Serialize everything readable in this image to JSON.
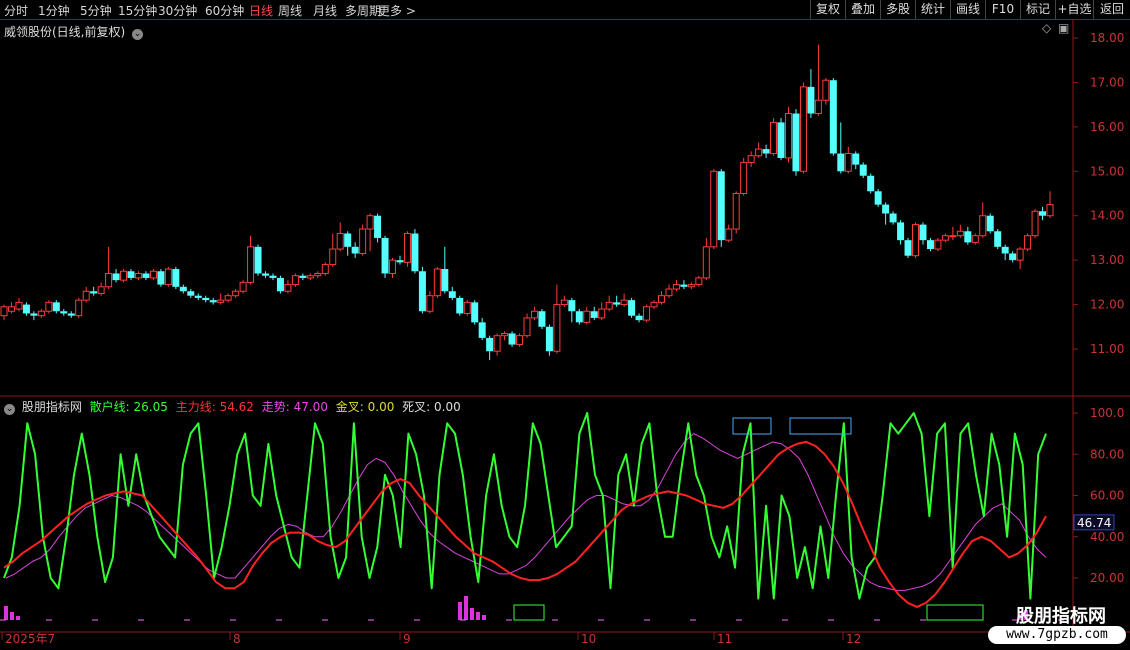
{
  "toolbar": {
    "timeframes": [
      "分时",
      "1分钟",
      "5分钟",
      "15分钟",
      "30分钟",
      "60分钟",
      "日线",
      "周线",
      "月线",
      "多周期",
      "更多 >"
    ],
    "active_timeframe": "日线",
    "right_buttons": [
      "复权",
      "叠加",
      "多股",
      "统计",
      "画线",
      "F10",
      "标记",
      "+自选",
      "返回"
    ]
  },
  "main_panel": {
    "title": "威领股份(日线,前复权)",
    "y_ticks": [
      "18.00",
      "17.00",
      "16.00",
      "15.00",
      "14.00",
      "13.00",
      "12.00",
      "11.00"
    ]
  },
  "indicator_panel": {
    "title": "股朋指标网",
    "legend": [
      {
        "label": "散户线: 26.05",
        "color": "#33ff33"
      },
      {
        "label": "主力线: 54.62",
        "color": "#ff3333"
      },
      {
        "label": "走势: 47.00",
        "color": "#ee44ee"
      },
      {
        "label": "金叉: 0.00",
        "color": "#dddd33"
      },
      {
        "label": "死叉: 0.00",
        "color": "#dddddd"
      }
    ],
    "y_ticks": [
      "100.0",
      "80.00",
      "60.00",
      "40.00",
      "20.00"
    ],
    "current_value": "46.74"
  },
  "x_axis": {
    "labels": [
      "2025年7",
      "8",
      "9",
      "10",
      "11",
      "12"
    ]
  },
  "watermark": {
    "name": "股朋指标网",
    "url": "www.7gpzb.com"
  },
  "chart_data": {
    "type": "candlestick",
    "candles": [
      [
        11.75,
        11.95,
        12.0,
        11.65
      ],
      [
        11.85,
        11.95,
        12.05,
        11.8
      ],
      [
        11.9,
        12.05,
        12.15,
        11.85
      ],
      [
        12.0,
        11.8,
        12.05,
        11.75
      ],
      [
        11.8,
        11.75,
        11.85,
        11.65
      ],
      [
        11.75,
        11.85,
        11.9,
        11.7
      ],
      [
        11.85,
        12.05,
        12.1,
        11.8
      ],
      [
        12.05,
        11.85,
        12.1,
        11.8
      ],
      [
        11.85,
        11.8,
        11.9,
        11.75
      ],
      [
        11.8,
        11.75,
        11.85,
        11.7
      ],
      [
        11.75,
        12.1,
        12.15,
        11.7
      ],
      [
        12.1,
        12.3,
        12.4,
        12.05
      ],
      [
        12.3,
        12.25,
        12.4,
        12.2
      ],
      [
        12.25,
        12.4,
        12.5,
        12.2
      ],
      [
        12.4,
        12.7,
        13.3,
        12.35
      ],
      [
        12.7,
        12.55,
        12.8,
        12.5
      ],
      [
        12.55,
        12.75,
        12.8,
        12.5
      ],
      [
        12.75,
        12.6,
        12.8,
        12.55
      ],
      [
        12.6,
        12.7,
        12.75,
        12.55
      ],
      [
        12.7,
        12.6,
        12.75,
        12.55
      ],
      [
        12.6,
        12.75,
        12.8,
        12.55
      ],
      [
        12.75,
        12.45,
        12.8,
        12.4
      ],
      [
        12.45,
        12.8,
        12.85,
        12.4
      ],
      [
        12.8,
        12.4,
        12.85,
        12.35
      ],
      [
        12.4,
        12.3,
        12.45,
        12.25
      ],
      [
        12.3,
        12.2,
        12.35,
        12.15
      ],
      [
        12.2,
        12.15,
        12.25,
        12.1
      ],
      [
        12.15,
        12.1,
        12.2,
        12.05
      ],
      [
        12.1,
        12.05,
        12.15,
        12.0
      ],
      [
        12.05,
        12.1,
        12.25,
        12.0
      ],
      [
        12.1,
        12.2,
        12.25,
        12.05
      ],
      [
        12.2,
        12.3,
        12.35,
        12.15
      ],
      [
        12.3,
        12.5,
        12.55,
        12.25
      ],
      [
        12.5,
        13.3,
        13.55,
        12.45
      ],
      [
        13.3,
        12.7,
        13.35,
        12.65
      ],
      [
        12.7,
        12.65,
        12.75,
        12.6
      ],
      [
        12.65,
        12.6,
        12.7,
        12.55
      ],
      [
        12.6,
        12.3,
        12.65,
        12.25
      ],
      [
        12.3,
        12.45,
        12.55,
        12.25
      ],
      [
        12.45,
        12.65,
        12.7,
        12.4
      ],
      [
        12.65,
        12.6,
        12.7,
        12.55
      ],
      [
        12.6,
        12.65,
        12.7,
        12.55
      ],
      [
        12.65,
        12.7,
        12.75,
        12.6
      ],
      [
        12.7,
        12.9,
        12.95,
        12.65
      ],
      [
        12.9,
        13.25,
        13.6,
        12.85
      ],
      [
        13.25,
        13.6,
        13.85,
        13.2
      ],
      [
        13.6,
        13.3,
        13.65,
        13.1
      ],
      [
        13.3,
        13.15,
        13.4,
        13.05
      ],
      [
        13.15,
        13.7,
        13.8,
        13.1
      ],
      [
        13.7,
        14.0,
        14.05,
        13.2
      ],
      [
        14.0,
        13.5,
        14.05,
        13.4
      ],
      [
        13.5,
        12.7,
        13.55,
        12.6
      ],
      [
        12.7,
        13.0,
        13.05,
        12.6
      ],
      [
        13.0,
        12.95,
        13.1,
        12.9
      ],
      [
        12.95,
        13.6,
        13.65,
        12.85
      ],
      [
        13.6,
        12.75,
        13.7,
        12.7
      ],
      [
        12.75,
        11.85,
        12.85,
        11.8
      ],
      [
        11.85,
        12.2,
        12.3,
        11.8
      ],
      [
        12.2,
        12.8,
        12.85,
        12.15
      ],
      [
        12.8,
        12.3,
        13.3,
        12.25
      ],
      [
        12.3,
        12.15,
        12.4,
        12.1
      ],
      [
        12.15,
        11.8,
        12.2,
        11.75
      ],
      [
        11.8,
        12.05,
        12.1,
        11.75
      ],
      [
        12.05,
        11.6,
        12.1,
        11.55
      ],
      [
        11.6,
        11.25,
        11.7,
        11.2
      ],
      [
        11.25,
        10.95,
        11.3,
        10.75
      ],
      [
        10.95,
        11.3,
        11.35,
        10.85
      ],
      [
        11.3,
        11.35,
        11.4,
        11.2
      ],
      [
        11.35,
        11.1,
        11.4,
        11.05
      ],
      [
        11.1,
        11.3,
        11.35,
        11.05
      ],
      [
        11.3,
        11.7,
        11.8,
        11.25
      ],
      [
        11.7,
        11.85,
        11.95,
        11.65
      ],
      [
        11.85,
        11.5,
        11.9,
        11.45
      ],
      [
        11.5,
        10.95,
        11.55,
        10.85
      ],
      [
        10.95,
        12.0,
        12.45,
        10.9
      ],
      [
        12.0,
        12.1,
        12.2,
        11.95
      ],
      [
        12.1,
        11.85,
        12.15,
        11.6
      ],
      [
        11.85,
        11.6,
        11.9,
        11.55
      ],
      [
        11.6,
        11.85,
        11.95,
        11.55
      ],
      [
        11.85,
        11.7,
        11.95,
        11.65
      ],
      [
        11.7,
        11.9,
        12.05,
        11.65
      ],
      [
        11.9,
        12.05,
        12.2,
        11.85
      ],
      [
        12.05,
        12.0,
        12.2,
        11.95
      ],
      [
        12.0,
        12.1,
        12.25,
        11.95
      ],
      [
        12.1,
        11.75,
        12.15,
        11.7
      ],
      [
        11.75,
        11.65,
        11.8,
        11.6
      ],
      [
        11.65,
        11.95,
        12.0,
        11.6
      ],
      [
        11.95,
        12.05,
        12.1,
        11.9
      ],
      [
        12.05,
        12.2,
        12.3,
        12.0
      ],
      [
        12.2,
        12.35,
        12.45,
        12.15
      ],
      [
        12.35,
        12.45,
        12.55,
        12.3
      ],
      [
        12.45,
        12.4,
        12.55,
        12.35
      ],
      [
        12.4,
        12.45,
        12.5,
        12.35
      ],
      [
        12.45,
        12.6,
        12.65,
        12.4
      ],
      [
        12.6,
        13.3,
        13.5,
        12.55
      ],
      [
        13.3,
        15.0,
        15.05,
        13.25
      ],
      [
        15.0,
        13.45,
        15.05,
        13.3
      ],
      [
        13.45,
        13.7,
        13.8,
        13.4
      ],
      [
        13.7,
        14.5,
        14.55,
        13.6
      ],
      [
        14.5,
        15.2,
        15.3,
        14.45
      ],
      [
        15.2,
        15.35,
        15.45,
        15.1
      ],
      [
        15.35,
        15.5,
        15.65,
        15.3
      ],
      [
        15.5,
        15.4,
        15.6,
        15.3
      ],
      [
        15.4,
        16.1,
        16.2,
        15.35
      ],
      [
        16.1,
        15.3,
        16.2,
        15.25
      ],
      [
        15.3,
        16.3,
        16.45,
        15.2
      ],
      [
        16.3,
        15.0,
        16.4,
        14.9
      ],
      [
        15.0,
        16.9,
        17.0,
        14.95
      ],
      [
        16.9,
        16.3,
        17.3,
        16.2
      ],
      [
        16.3,
        16.6,
        17.85,
        16.25
      ],
      [
        16.6,
        17.05,
        17.1,
        16.5
      ],
      [
        17.05,
        15.4,
        17.1,
        15.35
      ],
      [
        15.4,
        15.0,
        16.1,
        14.95
      ],
      [
        15.0,
        15.4,
        15.55,
        14.95
      ],
      [
        15.4,
        15.15,
        15.45,
        15.05
      ],
      [
        15.15,
        14.9,
        15.2,
        14.85
      ],
      [
        14.9,
        14.55,
        14.95,
        14.5
      ],
      [
        14.55,
        14.25,
        14.6,
        14.2
      ],
      [
        14.25,
        14.05,
        14.3,
        13.8
      ],
      [
        14.05,
        13.85,
        14.1,
        13.8
      ],
      [
        13.85,
        13.45,
        13.9,
        13.35
      ],
      [
        13.45,
        13.1,
        13.5,
        13.05
      ],
      [
        13.1,
        13.8,
        13.85,
        13.05
      ],
      [
        13.8,
        13.45,
        13.85,
        13.35
      ],
      [
        13.45,
        13.25,
        13.5,
        13.2
      ],
      [
        13.25,
        13.45,
        13.5,
        13.2
      ],
      [
        13.45,
        13.55,
        13.6,
        13.4
      ],
      [
        13.55,
        13.55,
        13.75,
        13.45
      ],
      [
        13.55,
        13.65,
        13.8,
        13.5
      ],
      [
        13.65,
        13.4,
        13.75,
        13.35
      ],
      [
        13.4,
        13.55,
        13.6,
        13.35
      ],
      [
        13.55,
        14.0,
        14.3,
        13.5
      ],
      [
        14.0,
        13.65,
        14.05,
        13.6
      ],
      [
        13.65,
        13.3,
        13.7,
        13.25
      ],
      [
        13.3,
        13.15,
        13.35,
        13.0
      ],
      [
        13.15,
        13.0,
        13.2,
        12.95
      ],
      [
        13.0,
        13.25,
        13.3,
        12.8
      ],
      [
        13.25,
        13.55,
        13.6,
        13.2
      ],
      [
        13.55,
        14.1,
        14.15,
        13.5
      ],
      [
        14.1,
        14.0,
        14.2,
        13.9
      ],
      [
        14.0,
        14.25,
        14.55,
        13.95
      ]
    ],
    "retail_line": [
      20,
      30,
      55,
      95,
      80,
      40,
      20,
      15,
      40,
      70,
      90,
      70,
      40,
      18,
      30,
      80,
      55,
      80,
      60,
      50,
      40,
      35,
      30,
      75,
      90,
      95,
      60,
      20,
      35,
      55,
      80,
      90,
      60,
      55,
      85,
      60,
      45,
      30,
      25,
      60,
      95,
      85,
      40,
      20,
      30,
      95,
      40,
      20,
      35,
      70,
      60,
      35,
      90,
      80,
      60,
      15,
      70,
      95,
      90,
      70,
      40,
      18,
      60,
      80,
      55,
      40,
      35,
      55,
      95,
      85,
      60,
      35,
      40,
      45,
      90,
      100,
      70,
      60,
      15,
      70,
      80,
      55,
      85,
      95,
      60,
      40,
      40,
      70,
      95,
      70,
      60,
      40,
      30,
      45,
      25,
      80,
      95,
      10,
      55,
      10,
      60,
      50,
      20,
      35,
      15,
      45,
      20,
      60,
      95,
      30,
      10,
      25,
      30,
      60,
      95,
      90,
      95,
      100,
      90,
      50,
      90,
      95,
      25,
      90,
      95,
      70,
      50,
      90,
      75,
      40,
      90,
      75,
      10,
      80,
      90
    ],
    "main_line": [
      25,
      28,
      32,
      35,
      38,
      42,
      46,
      50,
      53,
      56,
      58,
      60,
      61,
      62,
      61,
      60,
      55,
      50,
      45,
      40,
      35,
      30,
      24,
      18,
      15,
      15,
      18,
      26,
      32,
      37,
      40,
      42,
      42,
      41,
      38,
      36,
      35,
      38,
      44,
      50,
      56,
      62,
      66,
      68,
      66,
      60,
      55,
      50,
      45,
      40,
      36,
      32,
      30,
      28,
      25,
      22,
      20,
      19,
      19,
      20,
      22,
      25,
      28,
      33,
      38,
      43,
      48,
      53,
      56,
      58,
      60,
      61,
      62,
      61,
      60,
      58,
      56,
      55,
      54,
      56,
      60,
      65,
      70,
      75,
      80,
      83,
      85,
      86,
      84,
      80,
      74,
      66,
      56,
      45,
      35,
      25,
      18,
      12,
      8,
      6,
      8,
      12,
      18,
      25,
      32,
      38,
      40,
      38,
      34,
      30,
      32,
      36,
      42,
      50
    ],
    "trend_line": [
      20,
      22,
      25,
      28,
      30,
      34,
      40,
      45,
      50,
      54,
      56,
      58,
      60,
      59,
      57,
      55,
      52,
      48,
      44,
      40,
      36,
      32,
      28,
      24,
      22,
      20,
      20,
      25,
      30,
      35,
      40,
      44,
      46,
      45,
      42,
      40,
      40,
      45,
      52,
      60,
      68,
      75,
      78,
      76,
      70,
      62,
      55,
      48,
      42,
      38,
      35,
      32,
      30,
      28,
      26,
      24,
      22,
      22,
      24,
      26,
      30,
      35,
      40,
      45,
      50,
      54,
      58,
      60,
      60,
      58,
      56,
      55,
      55,
      58,
      64,
      72,
      80,
      86,
      90,
      88,
      85,
      82,
      80,
      78,
      80,
      82,
      84,
      86,
      85,
      82,
      78,
      70,
      60,
      50,
      40,
      32,
      26,
      22,
      18,
      16,
      15,
      14,
      14,
      15,
      16,
      18,
      22,
      28,
      34,
      40,
      46,
      50,
      54,
      56,
      52,
      48,
      40,
      34,
      30
    ]
  }
}
